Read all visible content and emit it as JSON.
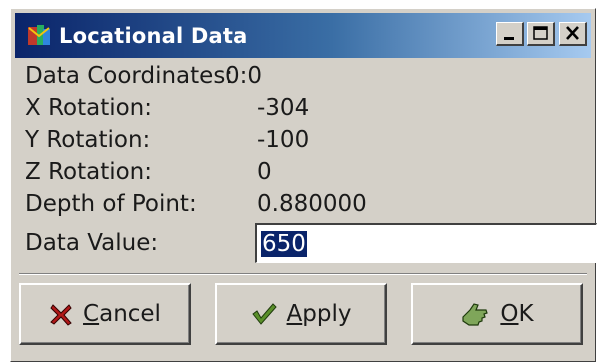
{
  "window": {
    "title": "Locational Data",
    "icon": "app-icon",
    "controls": [
      "minimize",
      "maximize",
      "close"
    ]
  },
  "fields": {
    "coords_label": "Data Coordinates:",
    "coords_value": "0:0",
    "x_label": "X Rotation:",
    "x_value": "-304",
    "y_label": "Y Rotation:",
    "y_value": "-100",
    "z_label": "Z Rotation:",
    "z_value": "0",
    "depth_label": "Depth of Point:",
    "depth_value": "0.880000",
    "data_value_label": "Data Value:",
    "data_value": "650"
  },
  "buttons": {
    "cancel": {
      "mnemonic": "C",
      "rest": "ancel",
      "icon": "x-mark-icon"
    },
    "apply": {
      "mnemonic": "A",
      "rest": "pply",
      "icon": "checkmark-icon"
    },
    "ok": {
      "mnemonic": "O",
      "rest": "K",
      "icon": "hand-icon"
    }
  },
  "colors": {
    "title_start": "#0a246a",
    "title_end": "#a6caf0",
    "face": "#d4d0c8",
    "selection": "#0a246a"
  }
}
